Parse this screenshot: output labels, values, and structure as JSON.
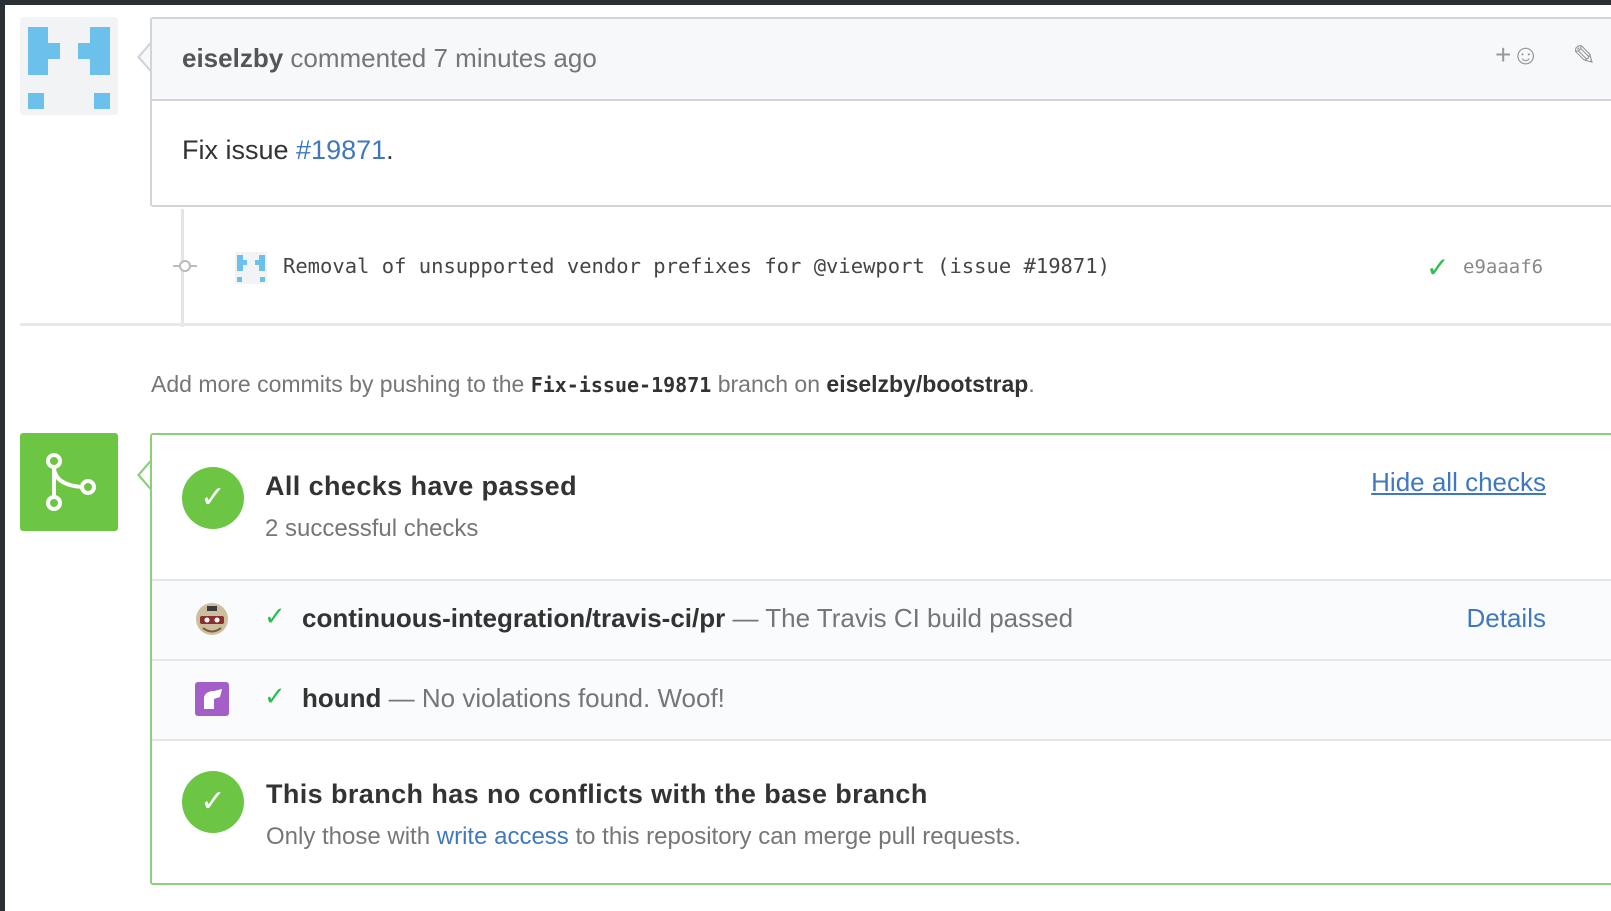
{
  "comment": {
    "author": "eiselzby",
    "action": "commented",
    "time": "7 minutes ago",
    "body_prefix": "Fix issue ",
    "body_link": "#19871",
    "body_suffix": ".",
    "reaction_icon": "add-reaction-icon",
    "edit_icon": "pencil-icon"
  },
  "commit": {
    "message": "Removal of unsupported vendor prefixes for @viewport (issue #19871)",
    "status_icon": "check-icon",
    "sha": "e9aaaf6"
  },
  "push_note": {
    "prefix": "Add more commits by pushing to the ",
    "branch": "Fix-issue-19871",
    "middle": " branch on ",
    "repo": "eiselzby/bootstrap",
    "suffix": "."
  },
  "checks": {
    "title": "All checks have passed",
    "subtitle": "2 successful checks",
    "toggle_label": "Hide all checks",
    "items": [
      {
        "context": "continuous-integration/travis-ci/pr",
        "separator": " — ",
        "description": "The Travis CI build passed",
        "details_label": "Details",
        "icon": "travis-ci-icon"
      },
      {
        "context": "hound",
        "separator": " — ",
        "description": "No violations found. Woof!",
        "details_label": "",
        "icon": "hound-icon"
      }
    ]
  },
  "merge": {
    "title": "This branch has no conflicts with the base branch",
    "sub_prefix": "Only those with ",
    "sub_link": "write access",
    "sub_suffix": " to this repository can merge pull requests."
  },
  "colors": {
    "success": "#6cc644",
    "link": "#4078c0",
    "identicon": "#6cc0ec"
  }
}
